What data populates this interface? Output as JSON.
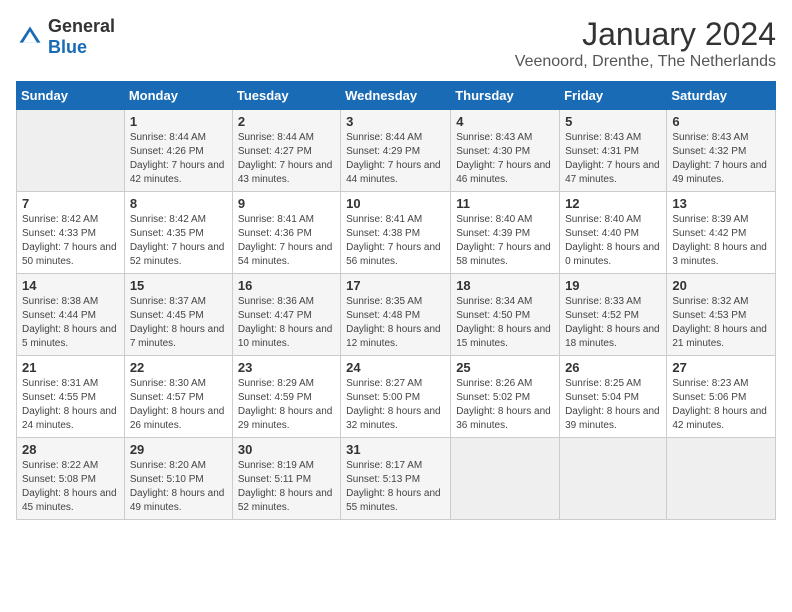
{
  "header": {
    "logo_general": "General",
    "logo_blue": "Blue",
    "title": "January 2024",
    "subtitle": "Veenoord, Drenthe, The Netherlands"
  },
  "weekdays": [
    "Sunday",
    "Monday",
    "Tuesday",
    "Wednesday",
    "Thursday",
    "Friday",
    "Saturday"
  ],
  "weeks": [
    [
      {
        "day": "",
        "empty": true
      },
      {
        "day": "1",
        "sunrise": "Sunrise: 8:44 AM",
        "sunset": "Sunset: 4:26 PM",
        "daylight": "Daylight: 7 hours and 42 minutes."
      },
      {
        "day": "2",
        "sunrise": "Sunrise: 8:44 AM",
        "sunset": "Sunset: 4:27 PM",
        "daylight": "Daylight: 7 hours and 43 minutes."
      },
      {
        "day": "3",
        "sunrise": "Sunrise: 8:44 AM",
        "sunset": "Sunset: 4:29 PM",
        "daylight": "Daylight: 7 hours and 44 minutes."
      },
      {
        "day": "4",
        "sunrise": "Sunrise: 8:43 AM",
        "sunset": "Sunset: 4:30 PM",
        "daylight": "Daylight: 7 hours and 46 minutes."
      },
      {
        "day": "5",
        "sunrise": "Sunrise: 8:43 AM",
        "sunset": "Sunset: 4:31 PM",
        "daylight": "Daylight: 7 hours and 47 minutes."
      },
      {
        "day": "6",
        "sunrise": "Sunrise: 8:43 AM",
        "sunset": "Sunset: 4:32 PM",
        "daylight": "Daylight: 7 hours and 49 minutes."
      }
    ],
    [
      {
        "day": "7",
        "sunrise": "Sunrise: 8:42 AM",
        "sunset": "Sunset: 4:33 PM",
        "daylight": "Daylight: 7 hours and 50 minutes."
      },
      {
        "day": "8",
        "sunrise": "Sunrise: 8:42 AM",
        "sunset": "Sunset: 4:35 PM",
        "daylight": "Daylight: 7 hours and 52 minutes."
      },
      {
        "day": "9",
        "sunrise": "Sunrise: 8:41 AM",
        "sunset": "Sunset: 4:36 PM",
        "daylight": "Daylight: 7 hours and 54 minutes."
      },
      {
        "day": "10",
        "sunrise": "Sunrise: 8:41 AM",
        "sunset": "Sunset: 4:38 PM",
        "daylight": "Daylight: 7 hours and 56 minutes."
      },
      {
        "day": "11",
        "sunrise": "Sunrise: 8:40 AM",
        "sunset": "Sunset: 4:39 PM",
        "daylight": "Daylight: 7 hours and 58 minutes."
      },
      {
        "day": "12",
        "sunrise": "Sunrise: 8:40 AM",
        "sunset": "Sunset: 4:40 PM",
        "daylight": "Daylight: 8 hours and 0 minutes."
      },
      {
        "day": "13",
        "sunrise": "Sunrise: 8:39 AM",
        "sunset": "Sunset: 4:42 PM",
        "daylight": "Daylight: 8 hours and 3 minutes."
      }
    ],
    [
      {
        "day": "14",
        "sunrise": "Sunrise: 8:38 AM",
        "sunset": "Sunset: 4:44 PM",
        "daylight": "Daylight: 8 hours and 5 minutes."
      },
      {
        "day": "15",
        "sunrise": "Sunrise: 8:37 AM",
        "sunset": "Sunset: 4:45 PM",
        "daylight": "Daylight: 8 hours and 7 minutes."
      },
      {
        "day": "16",
        "sunrise": "Sunrise: 8:36 AM",
        "sunset": "Sunset: 4:47 PM",
        "daylight": "Daylight: 8 hours and 10 minutes."
      },
      {
        "day": "17",
        "sunrise": "Sunrise: 8:35 AM",
        "sunset": "Sunset: 4:48 PM",
        "daylight": "Daylight: 8 hours and 12 minutes."
      },
      {
        "day": "18",
        "sunrise": "Sunrise: 8:34 AM",
        "sunset": "Sunset: 4:50 PM",
        "daylight": "Daylight: 8 hours and 15 minutes."
      },
      {
        "day": "19",
        "sunrise": "Sunrise: 8:33 AM",
        "sunset": "Sunset: 4:52 PM",
        "daylight": "Daylight: 8 hours and 18 minutes."
      },
      {
        "day": "20",
        "sunrise": "Sunrise: 8:32 AM",
        "sunset": "Sunset: 4:53 PM",
        "daylight": "Daylight: 8 hours and 21 minutes."
      }
    ],
    [
      {
        "day": "21",
        "sunrise": "Sunrise: 8:31 AM",
        "sunset": "Sunset: 4:55 PM",
        "daylight": "Daylight: 8 hours and 24 minutes."
      },
      {
        "day": "22",
        "sunrise": "Sunrise: 8:30 AM",
        "sunset": "Sunset: 4:57 PM",
        "daylight": "Daylight: 8 hours and 26 minutes."
      },
      {
        "day": "23",
        "sunrise": "Sunrise: 8:29 AM",
        "sunset": "Sunset: 4:59 PM",
        "daylight": "Daylight: 8 hours and 29 minutes."
      },
      {
        "day": "24",
        "sunrise": "Sunrise: 8:27 AM",
        "sunset": "Sunset: 5:00 PM",
        "daylight": "Daylight: 8 hours and 32 minutes."
      },
      {
        "day": "25",
        "sunrise": "Sunrise: 8:26 AM",
        "sunset": "Sunset: 5:02 PM",
        "daylight": "Daylight: 8 hours and 36 minutes."
      },
      {
        "day": "26",
        "sunrise": "Sunrise: 8:25 AM",
        "sunset": "Sunset: 5:04 PM",
        "daylight": "Daylight: 8 hours and 39 minutes."
      },
      {
        "day": "27",
        "sunrise": "Sunrise: 8:23 AM",
        "sunset": "Sunset: 5:06 PM",
        "daylight": "Daylight: 8 hours and 42 minutes."
      }
    ],
    [
      {
        "day": "28",
        "sunrise": "Sunrise: 8:22 AM",
        "sunset": "Sunset: 5:08 PM",
        "daylight": "Daylight: 8 hours and 45 minutes."
      },
      {
        "day": "29",
        "sunrise": "Sunrise: 8:20 AM",
        "sunset": "Sunset: 5:10 PM",
        "daylight": "Daylight: 8 hours and 49 minutes."
      },
      {
        "day": "30",
        "sunrise": "Sunrise: 8:19 AM",
        "sunset": "Sunset: 5:11 PM",
        "daylight": "Daylight: 8 hours and 52 minutes."
      },
      {
        "day": "31",
        "sunrise": "Sunrise: 8:17 AM",
        "sunset": "Sunset: 5:13 PM",
        "daylight": "Daylight: 8 hours and 55 minutes."
      },
      {
        "day": "",
        "empty": true
      },
      {
        "day": "",
        "empty": true
      },
      {
        "day": "",
        "empty": true
      }
    ]
  ]
}
